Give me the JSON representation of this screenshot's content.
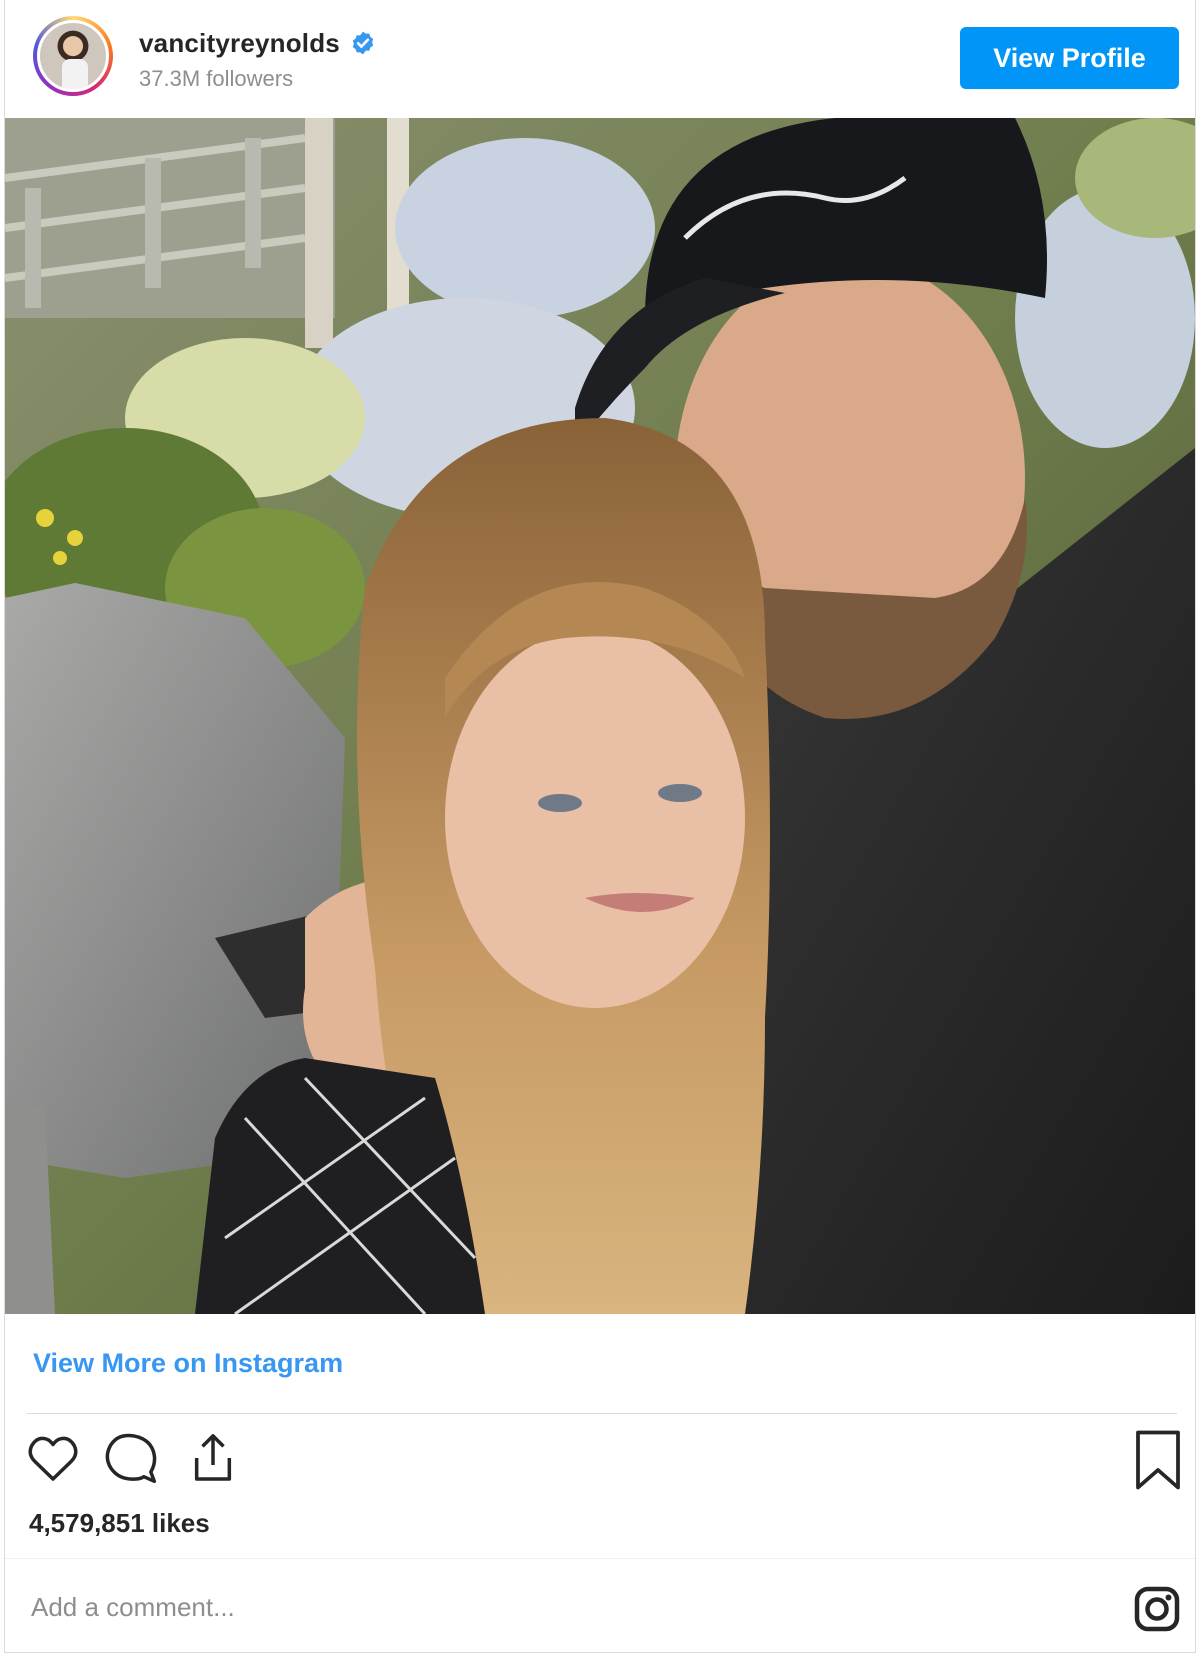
{
  "header": {
    "username": "vancityreynolds",
    "verified": true,
    "followers": "37.3M followers",
    "view_profile_label": "View Profile"
  },
  "post": {
    "image_description": "",
    "view_more_label": "View More on Instagram",
    "likes": "4,579,851 likes",
    "comment_placeholder": "Add a comment..."
  },
  "icons": {
    "like": "heart-icon",
    "comment": "comment-icon",
    "share": "share-icon",
    "save": "bookmark-icon",
    "instagram": "instagram-logo-icon",
    "verified": "verified-badge-icon"
  },
  "colors": {
    "accent": "#0095f6",
    "link": "#3897f0",
    "text": "#262626",
    "muted": "#8e8e8e"
  }
}
